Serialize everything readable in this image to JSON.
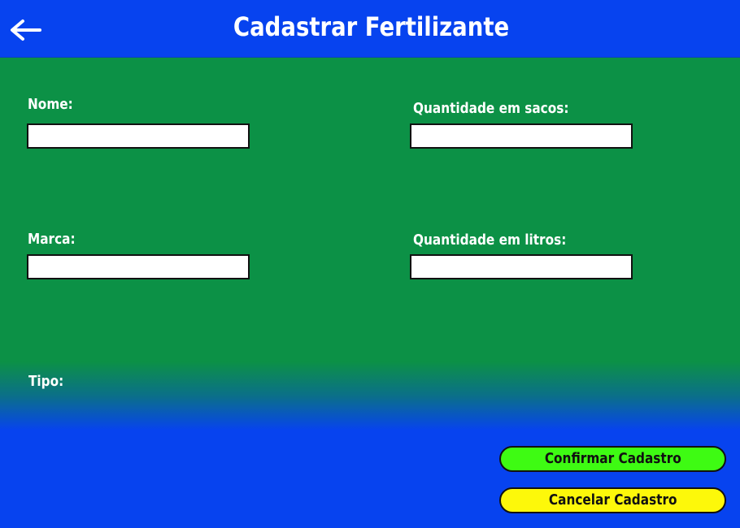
{
  "header": {
    "title": "Cadastrar Fertilizante",
    "back_icon": "arrow-left-icon"
  },
  "form": {
    "nome_label": "Nome:",
    "nome_value": "",
    "marca_label": "Marca:",
    "marca_value": "",
    "sacos_label": "Quantidade em sacos:",
    "sacos_value": "",
    "litros_label": "Quantidade em litros:",
    "litros_value": "",
    "tipo_label": "Tipo:"
  },
  "actions": {
    "confirm_label": "Confirmar Cadastro",
    "cancel_label": "Cancelar Cadastro"
  },
  "colors": {
    "header_bg": "#0743ef",
    "form_bg": "#0c9146",
    "confirm_bg": "#3efb13",
    "cancel_bg": "#fdf80a"
  }
}
